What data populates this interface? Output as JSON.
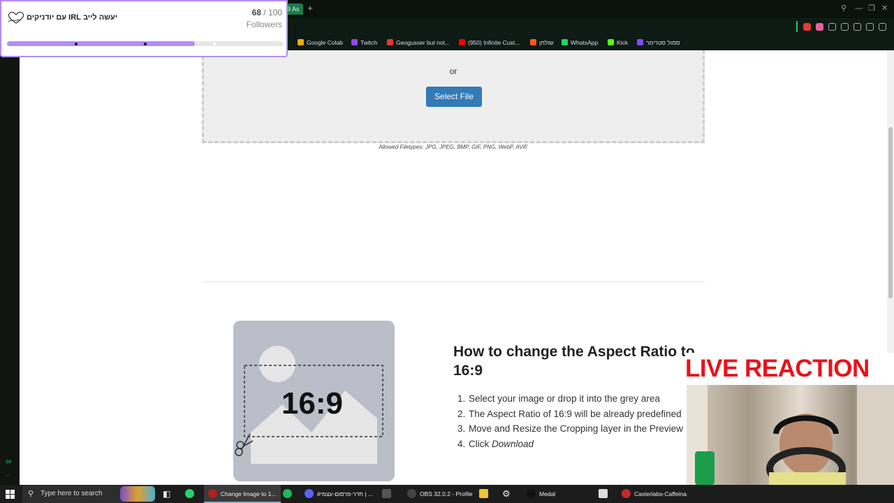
{
  "browser": {
    "active_tab_fragment": "9 As",
    "tab_add": "+",
    "bookmarks": [
      {
        "label": "Google Colab",
        "color": "#f9ab00"
      },
      {
        "label": "Twitch",
        "color": "#9146ff"
      },
      {
        "label": "Geogusser but not...",
        "color": "#e53935"
      },
      {
        "label": "(950) Infinite Cust...",
        "color": "#ff0000"
      },
      {
        "label": "שולחן",
        "color": "#ff5722"
      },
      {
        "label": "WhatsApp",
        "color": "#25d366"
      },
      {
        "label": "Kick",
        "color": "#53fc18"
      },
      {
        "label": "סמול סטרימר",
        "color": "#7c4dff"
      }
    ]
  },
  "page": {
    "or_text": "or",
    "select_file": "Select File",
    "filetypes": "Allowed Filetypes: JPG, JPEG, BMP, GIF, PNG, WebP, AVIF",
    "illustration_ratio": "16:9",
    "howto_title": "How to change the Aspect Ratio to 16:9",
    "steps": [
      {
        "number": "1.",
        "text": "Select your image or drop it into the grey area"
      },
      {
        "number": "2.",
        "text": "The Aspect Ratio of 16:9 will be already predefined"
      },
      {
        "number": "3.",
        "text": "Move and Resize the Cropping layer in the Preview"
      },
      {
        "number": "4.",
        "text": "Click",
        "emphasis": "Download"
      }
    ]
  },
  "overlay": {
    "goal_title": "יעשה לייב IRL עם יודניקים",
    "current": "68",
    "separator": "/",
    "goal": "100",
    "unit": "Followers",
    "progress_fraction": 0.68,
    "live_banner": "LIVE REACTION"
  },
  "left_rail": {
    "text1": "ox",
    "text2": "..."
  },
  "taskbar": {
    "search_placeholder": "Type here to search",
    "apps": [
      {
        "label": "Change Image to 1...",
        "active": true
      },
      {
        "label": "#חדר-פרסום-עצמי | ...",
        "active": false
      },
      {
        "label": "OBS 32.0.2 - Profile:...",
        "active": false
      },
      {
        "label": "Medal",
        "active": false
      },
      {
        "label": "Casterlabs-Caffeina...",
        "active": false
      }
    ]
  },
  "colors": {
    "accent_purple": "#b48cf5",
    "button_blue": "#337ab7",
    "live_red": "#e8121b"
  }
}
